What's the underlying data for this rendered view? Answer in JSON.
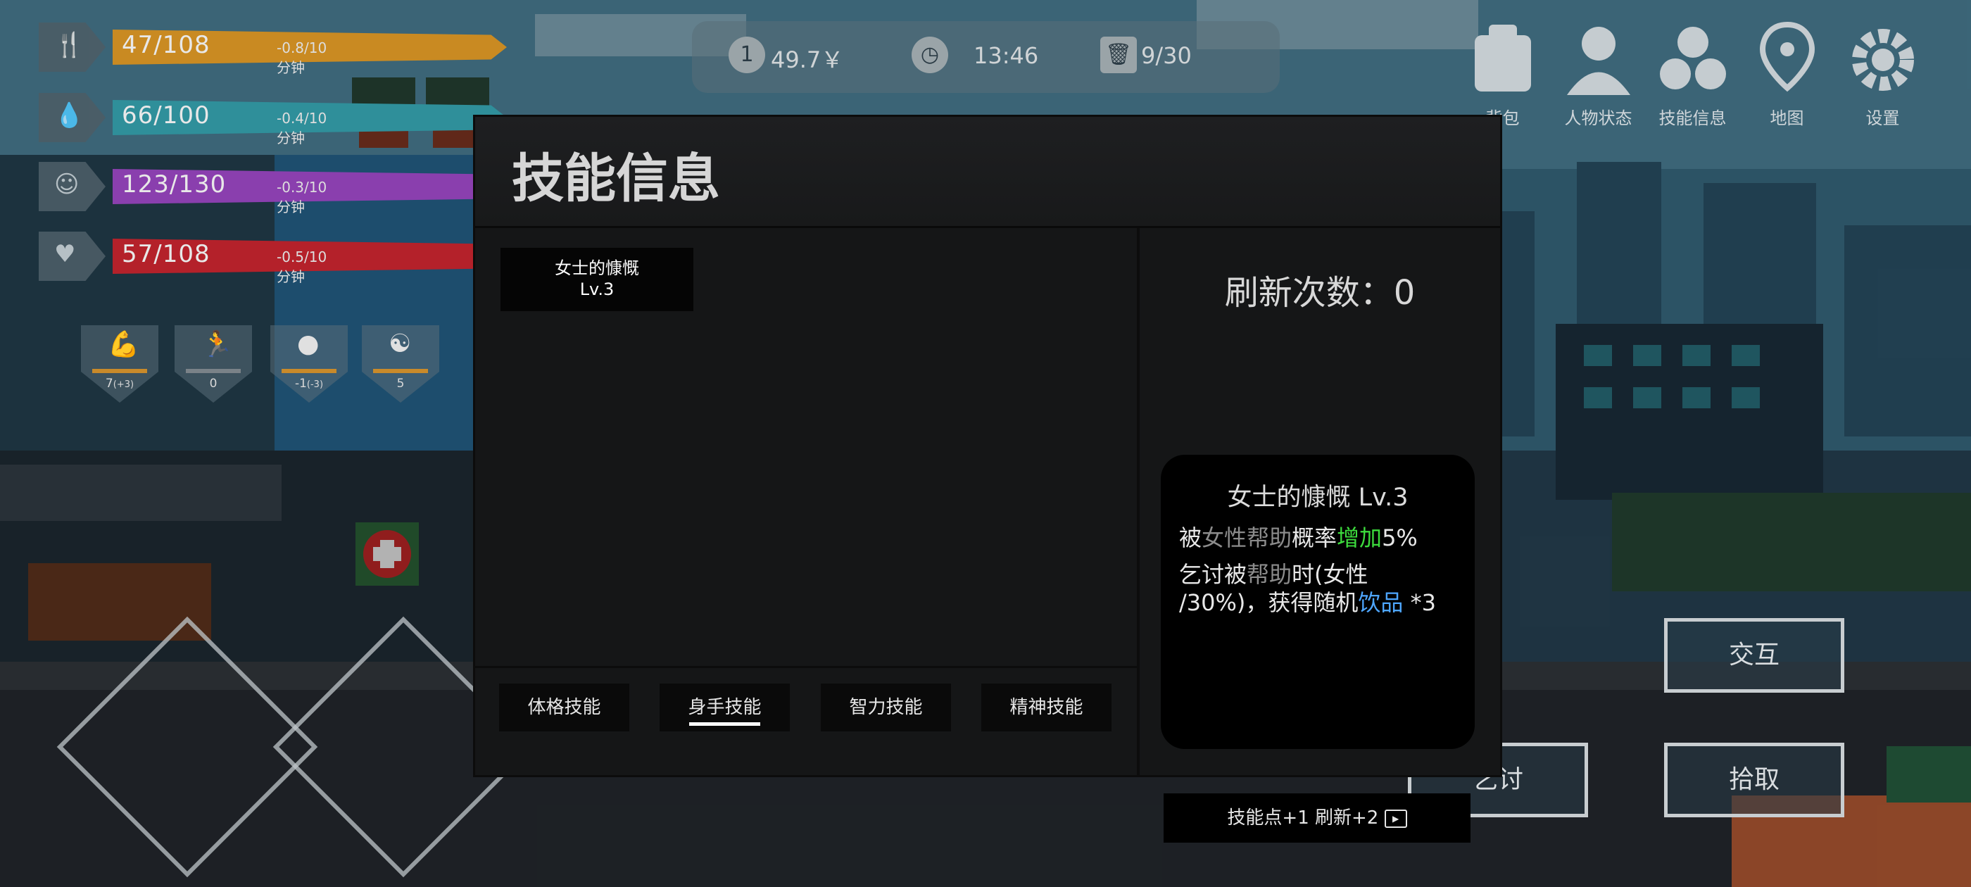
{
  "hud": {
    "stats": [
      {
        "icon": "fork-knife-icon",
        "value": "47/108",
        "rate": "-0.8/10分钟",
        "color": "#c98a22"
      },
      {
        "icon": "water-drop-icon",
        "value": "66/100",
        "rate": "-0.4/10分钟",
        "color": "#2f8f9a"
      },
      {
        "icon": "face-icon",
        "value": "123/130",
        "rate": "-0.3/10分钟",
        "color": "#8a3fae"
      },
      {
        "icon": "heartbeat-icon",
        "value": "57/108",
        "rate": "-0.5/10分钟",
        "color": "#b4212a"
      }
    ],
    "attributes": [
      {
        "icon": "muscle-icon",
        "value": "7",
        "bonus": "(+3)"
      },
      {
        "icon": "running-icon",
        "value": "0",
        "bonus": ""
      },
      {
        "icon": "head-icon",
        "value": "-1",
        "bonus": "(-3)"
      },
      {
        "icon": "meditation-icon",
        "value": "5",
        "bonus": ""
      }
    ]
  },
  "topbar": {
    "money": "49.7￥",
    "time": "13:46",
    "trash": "9/30"
  },
  "menu": [
    {
      "label": "背包",
      "icon": "backpack-icon"
    },
    {
      "label": "人物状态",
      "icon": "person-icon"
    },
    {
      "label": "技能信息",
      "icon": "skills-icon"
    },
    {
      "label": "地图",
      "icon": "map-icon"
    },
    {
      "label": "设置",
      "icon": "gear-icon"
    }
  ],
  "actions": {
    "interact": "交互",
    "beg": "乞讨",
    "pickup": "拾取"
  },
  "modal": {
    "title": "技能信息",
    "skill_card": {
      "name": "女士的慷慨",
      "level": "Lv.3"
    },
    "tabs": [
      "体格技能",
      "身手技能",
      "智力技能",
      "精神技能"
    ],
    "active_tab": 1,
    "refresh_label": "刷新次数：0",
    "detail": {
      "title": "女士的慷慨 Lv.3",
      "line1": {
        "a": "被",
        "b": "女性帮助",
        "c": "概率",
        "d": "增加",
        "e": "5%"
      },
      "line2": {
        "a": "乞讨被",
        "b": "帮助",
        "c": "时(女性",
        "d": "/30%)，获得随机",
        "e": "饮品",
        "f": " *3"
      }
    },
    "bottom_button": "技能点+1 刷新+2"
  }
}
